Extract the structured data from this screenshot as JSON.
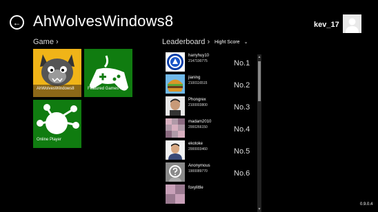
{
  "header": {
    "back_glyph": "←",
    "title": "AhWolvesWindows8",
    "username": "kev_17"
  },
  "game_section": {
    "heading": "Game ›",
    "tiles": [
      {
        "label": "AhWolvesWindows8",
        "icon": "wolf-character-icon",
        "color": "#f0b418"
      },
      {
        "label": "Featured Games",
        "icon": "gamepad-icon",
        "color": "#107c10"
      },
      {
        "label": "Online Player",
        "icon": "network-icon",
        "color": "#107c10"
      }
    ]
  },
  "leaderboard": {
    "heading": "Leaderboard ›",
    "sort_label": "Hight Score",
    "sort_chevron": "⌄",
    "entries": [
      {
        "name": "harryhuy10",
        "score": "2147190775",
        "rank": "No.1",
        "avatar": "chelsea-badge-icon"
      },
      {
        "name": "jianing",
        "score": "2100116515",
        "rank": "No.2",
        "avatar": "burger-icon"
      },
      {
        "name": "Phongrex",
        "score": "2100003800",
        "rank": "No.3",
        "avatar": "person-photo-icon"
      },
      {
        "name": "madam2010",
        "score": "2000266150",
        "rank": "No.4",
        "avatar": "pattern-photo-icon"
      },
      {
        "name": "ekotoke",
        "score": "2000003460",
        "rank": "No.5",
        "avatar": "person-photo-icon"
      },
      {
        "name": "Anonymous",
        "score": "1900089770",
        "rank": "No.6",
        "avatar": "question-mark-icon"
      },
      {
        "name": "foxylittle",
        "score": "",
        "rank": "",
        "avatar": "pattern-photo-icon"
      }
    ]
  },
  "scroll": {
    "up": "▲",
    "down": "▼"
  },
  "footer": {
    "version": "0.9.0.4"
  }
}
